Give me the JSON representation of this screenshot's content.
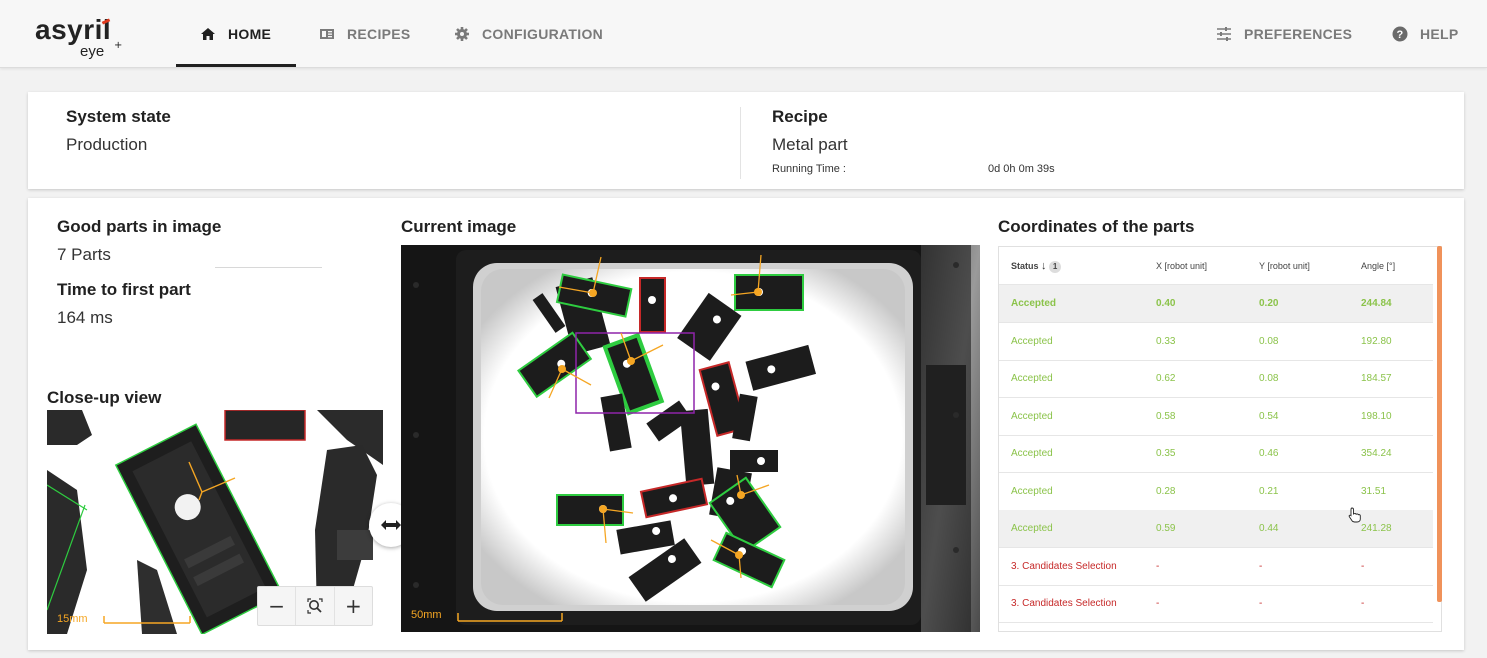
{
  "nav": {
    "logo_main": "asyril",
    "logo_sub": "eye",
    "logo_plus": "+",
    "home": "HOME",
    "recipes": "RECIPES",
    "configuration": "CONFIGURATION",
    "preferences": "PREFERENCES",
    "help": "HELP"
  },
  "status": {
    "system_state_label": "System state",
    "system_state_value": "Production",
    "recipe_label": "Recipe",
    "recipe_value": "Metal part",
    "running_time_label": "Running Time :",
    "running_time_value": "0d 0h 0m 39s"
  },
  "stats": {
    "good_parts_label": "Good parts in image",
    "good_parts_value": "7 Parts",
    "time_first_label": "Time to first part",
    "time_first_value": "164 ms"
  },
  "closeup": {
    "title": "Close-up view",
    "scale": "15mm",
    "zoom_out": "−",
    "zoom_in": "+"
  },
  "current": {
    "title": "Current image",
    "scale": "50mm"
  },
  "coords": {
    "title": "Coordinates of the parts",
    "headers": {
      "status": "Status",
      "sort_badge": "1",
      "x": "X [robot unit]",
      "y": "Y [robot unit]",
      "angle": "Angle [°]"
    },
    "rows": [
      {
        "status": "Accepted",
        "x": "0.40",
        "y": "0.20",
        "angle": "244.84",
        "kind": "ok",
        "highlight": true,
        "bold": true
      },
      {
        "status": "Accepted",
        "x": "0.33",
        "y": "0.08",
        "angle": "192.80",
        "kind": "ok"
      },
      {
        "status": "Accepted",
        "x": "0.62",
        "y": "0.08",
        "angle": "184.57",
        "kind": "ok"
      },
      {
        "status": "Accepted",
        "x": "0.58",
        "y": "0.54",
        "angle": "198.10",
        "kind": "ok"
      },
      {
        "status": "Accepted",
        "x": "0.35",
        "y": "0.46",
        "angle": "354.24",
        "kind": "ok"
      },
      {
        "status": "Accepted",
        "x": "0.28",
        "y": "0.21",
        "angle": "31.51",
        "kind": "ok"
      },
      {
        "status": "Accepted",
        "x": "0.59",
        "y": "0.44",
        "angle": "241.28",
        "kind": "ok",
        "highlight": true
      },
      {
        "status": "3. Candidates Selection",
        "x": "-",
        "y": "-",
        "angle": "-",
        "kind": "bad"
      },
      {
        "status": "3. Candidates Selection",
        "x": "-",
        "y": "-",
        "angle": "-",
        "kind": "bad"
      }
    ]
  },
  "colors": {
    "accepted": "#8bc34a",
    "rejected": "#c62828",
    "accent": "#f0925a",
    "annotation": "#f5a623"
  }
}
